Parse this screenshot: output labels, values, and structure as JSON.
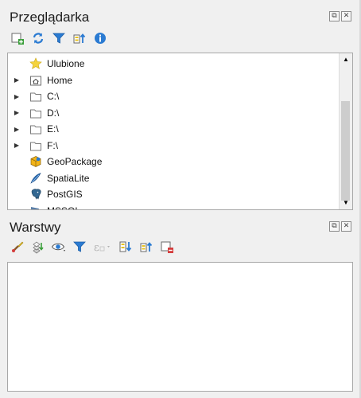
{
  "browser_panel": {
    "title": "Przeglądarka",
    "toolbar": [
      {
        "name": "add-layer-icon"
      },
      {
        "name": "refresh-icon"
      },
      {
        "name": "filter-icon"
      },
      {
        "name": "collapse-all-icon"
      },
      {
        "name": "info-icon"
      }
    ],
    "items": [
      {
        "label": "Ulubione",
        "icon": "star-icon",
        "expandable": false
      },
      {
        "label": "Home",
        "icon": "home-folder-icon",
        "expandable": true
      },
      {
        "label": "C:\\",
        "icon": "folder-icon",
        "expandable": true
      },
      {
        "label": "D:\\",
        "icon": "folder-icon",
        "expandable": true
      },
      {
        "label": "E:\\",
        "icon": "folder-icon",
        "expandable": true
      },
      {
        "label": "F:\\",
        "icon": "folder-icon",
        "expandable": true
      },
      {
        "label": "GeoPackage",
        "icon": "geopackage-icon",
        "expandable": false
      },
      {
        "label": "SpatiaLite",
        "icon": "spatialite-icon",
        "expandable": false
      },
      {
        "label": "PostGIS",
        "icon": "postgis-icon",
        "expandable": false
      },
      {
        "label": "MSSQL",
        "icon": "mssql-icon",
        "expandable": false
      }
    ]
  },
  "layers_panel": {
    "title": "Warstwy",
    "toolbar": [
      {
        "name": "style-brush-icon"
      },
      {
        "name": "add-group-icon"
      },
      {
        "name": "visibility-eye-icon"
      },
      {
        "name": "filter-icon"
      },
      {
        "name": "filter-expression-icon",
        "disabled": true
      },
      {
        "name": "expand-all-icon"
      },
      {
        "name": "collapse-all-icon"
      },
      {
        "name": "remove-layer-icon"
      }
    ]
  },
  "colors": {
    "panel_bg": "#f0f0f0",
    "content_bg": "#ffffff",
    "border": "#a8a8a8",
    "accent_blue": "#2b7bd2",
    "accent_yellow": "#e8c21f"
  }
}
